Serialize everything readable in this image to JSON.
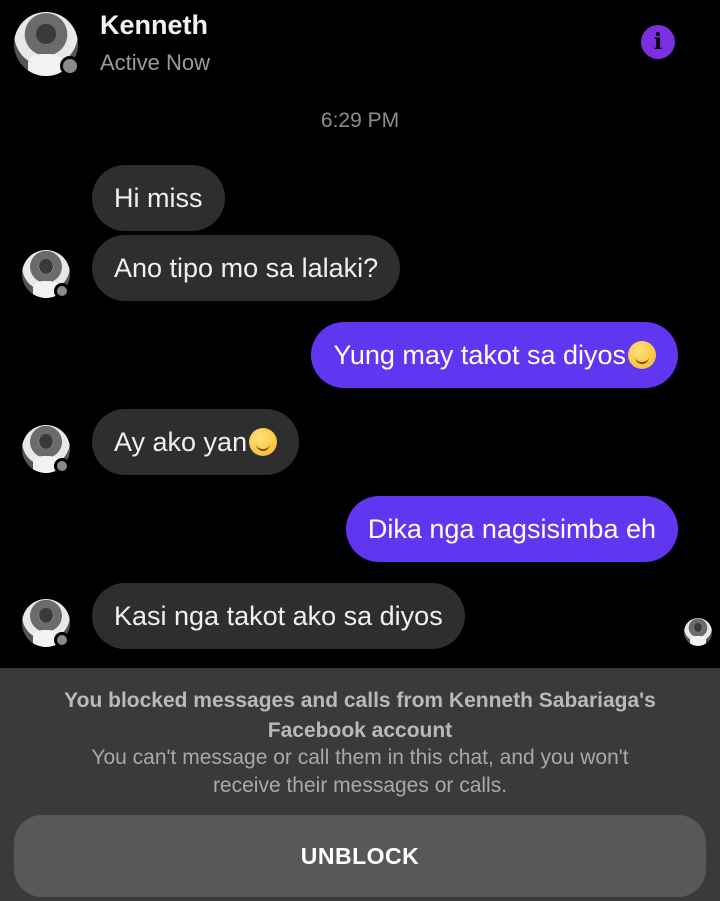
{
  "header": {
    "name": "Kenneth",
    "status": "Active Now",
    "info_icon": "info-icon",
    "info_glyph": "i"
  },
  "chat": {
    "timestamp": "6:29 PM",
    "messages": [
      {
        "from": "them",
        "text": "Hi miss"
      },
      {
        "from": "them",
        "text": "Ano tipo mo sa lalaki?"
      },
      {
        "from": "me",
        "text": "Yung may takot sa diyos",
        "emoji": "smiling-face-with-halo-emoji"
      },
      {
        "from": "them",
        "text": "Ay ako yan",
        "emoji": "smiling-face-emoji"
      },
      {
        "from": "me",
        "text": "Dika nga nagsisimba eh"
      },
      {
        "from": "them",
        "text": "Kasi nga takot ako sa diyos"
      }
    ]
  },
  "blocked": {
    "title_line1": "You blocked messages and calls from Kenneth Sabariaga's",
    "title_line2": "Facebook account",
    "sub_line1": "You can't message or call them in this chat, and you won't",
    "sub_line2": "receive their messages or calls.",
    "button_label": "UNBLOCK"
  },
  "colors": {
    "background": "#000000",
    "incoming_bubble": "#2e2e2e",
    "outgoing_bubble": "#6136f0",
    "info_button": "#7a2fe0",
    "blocked_panel": "#3a3a3a",
    "unblock_button": "#585858"
  }
}
